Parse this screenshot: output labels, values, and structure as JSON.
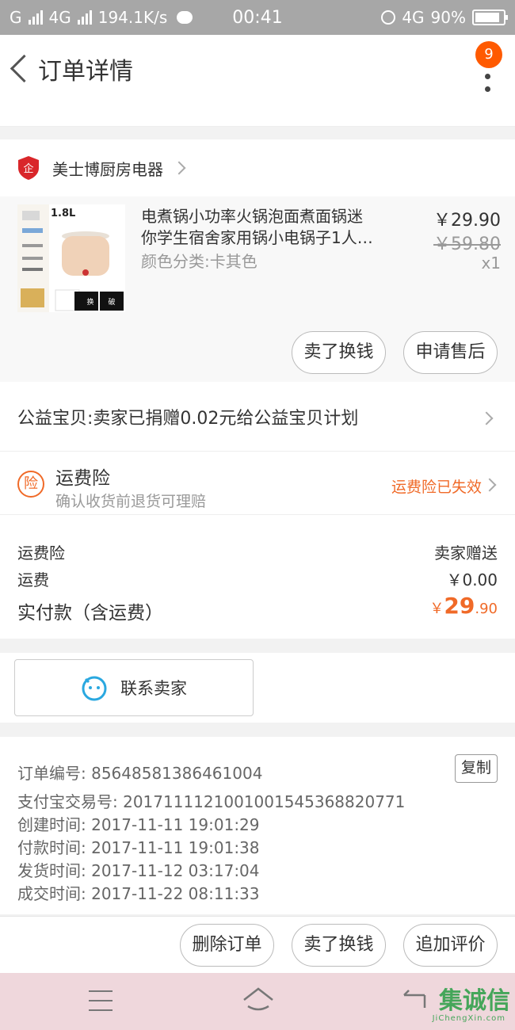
{
  "status_bar": {
    "carrier1": "G",
    "net": "4G",
    "speed": "194.1K/s",
    "time": "00:41",
    "net2": "4G",
    "battery": "90%"
  },
  "header": {
    "title": "订单详情",
    "badge": "9"
  },
  "shop": {
    "name": "美士博厨房电器"
  },
  "item": {
    "title_line1": "电煮锅小功率火锅泡面煮面锅迷",
    "title_line2": "你学生宿舍家用锅小电锅子1人…",
    "sku": "颜色分类:卡其色",
    "price": "￥29.90",
    "original_price": "￥59.80",
    "quantity": "x1",
    "thumb_caption": "1.8L"
  },
  "item_actions": {
    "sell": "卖了换钱",
    "after_sale": "申请售后"
  },
  "charity": {
    "text": "公益宝贝:卖家已捐赠0.02元给公益宝贝计划"
  },
  "insurance": {
    "icon_char": "险",
    "title": "运费险",
    "subtitle": "确认收货前退货可理赔",
    "status": "运费险已失效"
  },
  "fees": {
    "insurance_label": "运费险",
    "insurance_value": "卖家赠送",
    "shipping_label": "运费",
    "shipping_value": "￥0.00",
    "total_label": "实付款（含运费）",
    "total_currency": "￥",
    "total_int": "29",
    "total_dec": ".90"
  },
  "contact": {
    "label": "联系卖家"
  },
  "order_info": {
    "order_no": "订单编号: 85648581386461004",
    "alipay_no": "支付宝交易号: 2017111121001001545368820771",
    "created": "创建时间: 2017-11-11 19:01:29",
    "paid": "付款时间: 2017-11-11 19:01:38",
    "shipped": "发货时间: 2017-11-12 03:17:04",
    "completed": "成交时间: 2017-11-22 08:11:33",
    "copy": "复制"
  },
  "bottom_actions": {
    "delete": "删除订单",
    "sell": "卖了换钱",
    "review": "追加评价"
  },
  "watermark": {
    "brand": "集诚信",
    "domain": "JiChengXin.com"
  },
  "colors": {
    "accent": "#f06a28",
    "badge": "#ff5a00",
    "status_bar": "#a7a7a7"
  }
}
